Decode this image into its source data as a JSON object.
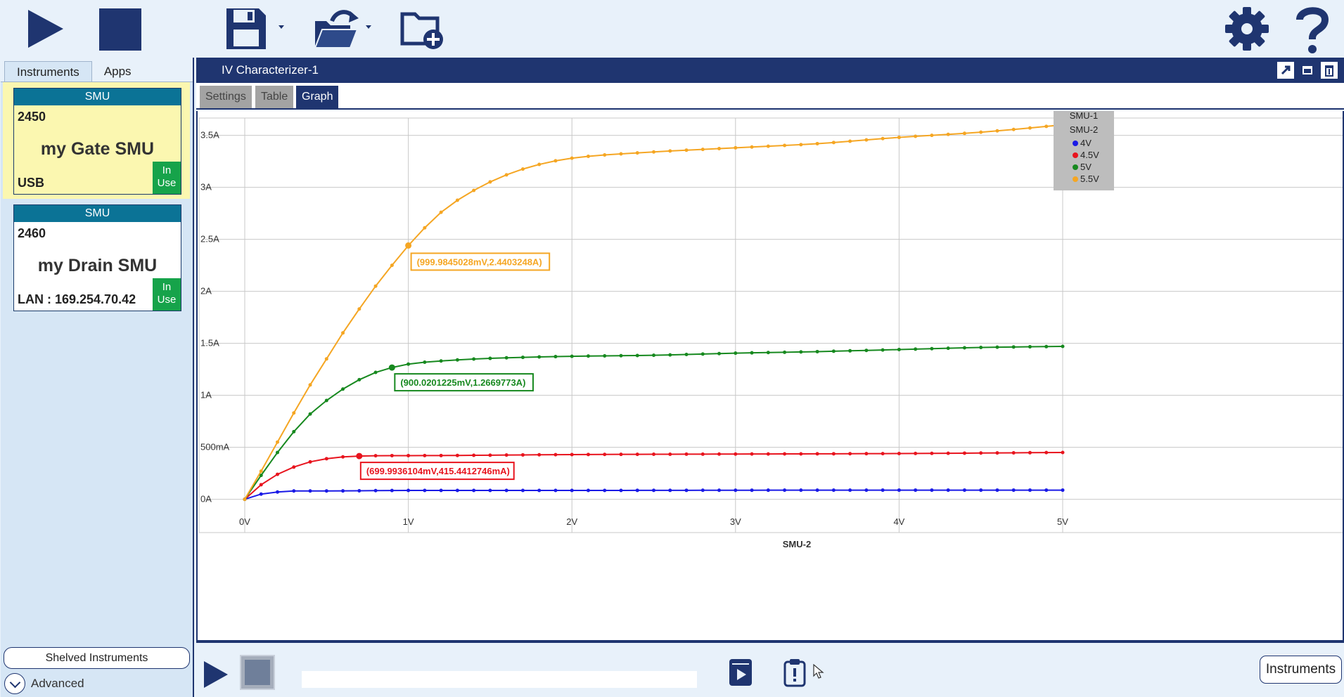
{
  "toolbar": {
    "icons": [
      "run-icon",
      "stop-icon",
      "save-icon",
      "open-icon",
      "new-folder-icon",
      "settings-icon",
      "help-icon"
    ],
    "accent": "#1f3570"
  },
  "sidebar": {
    "tabs": [
      "Instruments",
      "Apps"
    ],
    "instruments": [
      {
        "type": "SMU",
        "model": "2450",
        "name": "my Gate SMU",
        "connection": "USB",
        "status": "In Use"
      },
      {
        "type": "SMU",
        "model": "2460",
        "name": "my Drain SMU",
        "connection": "LAN : 169.254.70.42",
        "status": "In Use"
      }
    ],
    "shelved_label": "Shelved Instruments",
    "advanced_label": "Advanced"
  },
  "panel": {
    "title": "IV Characterizer-1",
    "tabs": [
      "Settings",
      "Table",
      "Graph"
    ],
    "active_tab": "Graph"
  },
  "chart_data": {
    "type": "line",
    "xlabel": "SMU-2",
    "ylabel": "",
    "xlim": [
      0,
      5
    ],
    "ylim": [
      -0.05,
      3.7
    ],
    "grid": true,
    "x_ticks": [
      "0V",
      "1V",
      "2V",
      "3V",
      "4V",
      "5V"
    ],
    "y_ticks": [
      "0A",
      "500mA",
      "1A",
      "1.5A",
      "2A",
      "2.5A",
      "3A",
      "3.5A"
    ],
    "legend": {
      "titles": [
        "SMU-1",
        "SMU-2"
      ],
      "placement": "top-right"
    },
    "series": [
      {
        "name": "4V",
        "color": "#1a1ae6",
        "knots": [
          [
            0,
            0
          ],
          [
            0.1,
            0.05
          ],
          [
            0.2,
            0.07
          ],
          [
            0.3,
            0.08
          ],
          [
            0.5,
            0.08
          ],
          [
            1,
            0.085
          ],
          [
            2,
            0.085
          ],
          [
            3,
            0.087
          ],
          [
            4,
            0.088
          ],
          [
            5,
            0.088
          ]
        ]
      },
      {
        "name": "4.5V",
        "color": "#e8141e",
        "knots": [
          [
            0,
            0
          ],
          [
            0.1,
            0.14
          ],
          [
            0.2,
            0.24
          ],
          [
            0.3,
            0.31
          ],
          [
            0.4,
            0.36
          ],
          [
            0.5,
            0.39
          ],
          [
            0.6,
            0.408
          ],
          [
            0.7,
            0.4154
          ],
          [
            0.9,
            0.42
          ],
          [
            1,
            0.42
          ],
          [
            2,
            0.43
          ],
          [
            3,
            0.435
          ],
          [
            4,
            0.44
          ],
          [
            5,
            0.45
          ]
        ]
      },
      {
        "name": "5V",
        "color": "#17891f",
        "knots": [
          [
            0,
            0
          ],
          [
            0.1,
            0.23
          ],
          [
            0.2,
            0.45
          ],
          [
            0.3,
            0.65
          ],
          [
            0.4,
            0.82
          ],
          [
            0.5,
            0.95
          ],
          [
            0.6,
            1.06
          ],
          [
            0.7,
            1.15
          ],
          [
            0.8,
            1.22
          ],
          [
            0.9,
            1.267
          ],
          [
            1,
            1.3
          ],
          [
            1.2,
            1.33
          ],
          [
            1.5,
            1.355
          ],
          [
            2,
            1.375
          ],
          [
            2.5,
            1.385
          ],
          [
            3,
            1.405
          ],
          [
            3.5,
            1.42
          ],
          [
            4,
            1.44
          ],
          [
            4.5,
            1.46
          ],
          [
            5,
            1.47
          ]
        ]
      },
      {
        "name": "5.5V",
        "color": "#f5a623",
        "knots": [
          [
            0,
            0
          ],
          [
            0.1,
            0.27
          ],
          [
            0.2,
            0.55
          ],
          [
            0.3,
            0.83
          ],
          [
            0.4,
            1.1
          ],
          [
            0.5,
            1.35
          ],
          [
            0.6,
            1.6
          ],
          [
            0.7,
            1.83
          ],
          [
            0.8,
            2.05
          ],
          [
            0.9,
            2.25
          ],
          [
            1,
            2.44
          ],
          [
            1.2,
            2.76
          ],
          [
            1.4,
            2.97
          ],
          [
            1.6,
            3.12
          ],
          [
            1.8,
            3.22
          ],
          [
            2,
            3.28
          ],
          [
            2.5,
            3.34
          ],
          [
            3,
            3.38
          ],
          [
            3.5,
            3.42
          ],
          [
            4,
            3.48
          ],
          [
            4.5,
            3.53
          ],
          [
            5,
            3.6
          ]
        ]
      }
    ],
    "markers": [
      {
        "series": "5.5V",
        "x": 0.9999845028,
        "y": 2.4403248,
        "label": "(999.9845028mV,2.4403248A)"
      },
      {
        "series": "5V",
        "x": 0.9000201225,
        "y": 1.2669773,
        "label": "(900.0201225mV,1.2669773A)"
      },
      {
        "series": "4.5V",
        "x": 0.6999936104,
        "y": 0.4154412746,
        "label": "(699.9936104mV,415.4412746mA)"
      }
    ]
  },
  "bottom": {
    "instruments_button": "Instruments"
  }
}
